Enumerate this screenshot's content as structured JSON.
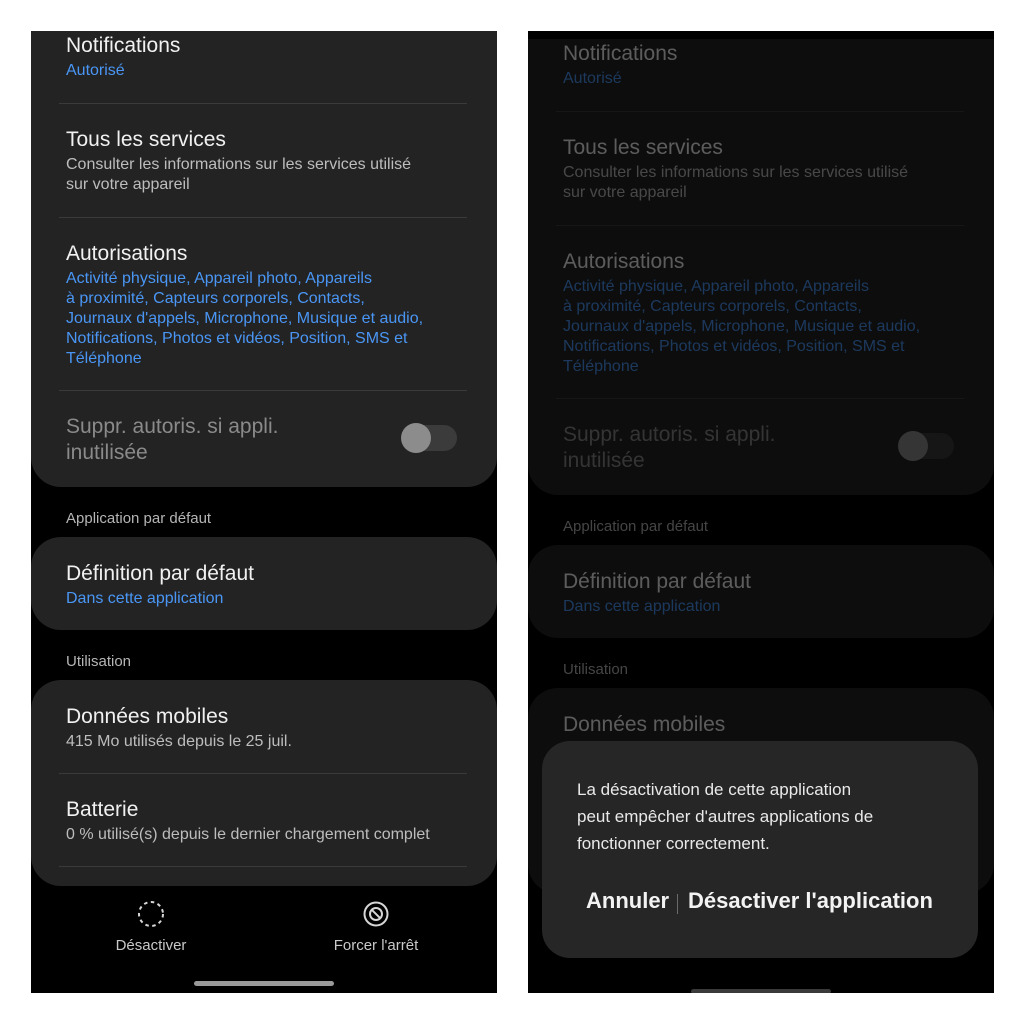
{
  "settings": {
    "notifications": {
      "title": "Notifications",
      "value": "Autorisé"
    },
    "services": {
      "title": "Tous les services",
      "desc_line1": "Consulter les informations sur les services utilisé",
      "desc_line2": "sur votre appareil"
    },
    "permissions": {
      "title": "Autorisations",
      "lines": [
        "Activité physique, Appareil photo, Appareils",
        "à proximité, Capteurs corporels, Contacts,",
        "Journaux d'appels, Microphone, Musique et audio,",
        "Notifications, Photos et vidéos, Position, SMS et",
        "Téléphone"
      ]
    },
    "remove_perms": {
      "line1": "Suppr. autoris. si appli.",
      "line2": "inutilisée",
      "enabled": false
    },
    "default_app_section": "Application par défaut",
    "default_setting": {
      "title": "Définition par défaut",
      "value": "Dans cette application"
    },
    "usage_section": "Utilisation",
    "mobile_data": {
      "title": "Données mobiles",
      "value": "415 Mo utilisés depuis le 25 juil."
    },
    "battery": {
      "title": "Batterie",
      "value": "0 % utilisé(s) depuis le dernier chargement complet"
    }
  },
  "bottom_bar": {
    "disable": {
      "label": "Désactiver",
      "icon": "dashed-circle-icon"
    },
    "force_stop": {
      "label": "Forcer l'arrêt",
      "icon": "stop-circle-icon"
    }
  },
  "dialog": {
    "message_lines": [
      "La désactivation de cette application",
      "peut empêcher d'autres applications de",
      "fonctionner correctement."
    ],
    "cancel_label": "Annuler",
    "confirm_label": "Désactiver l'application"
  },
  "colors": {
    "card_bg": "#232323",
    "link_blue": "#4a96f5",
    "dialog_bg": "#262626"
  }
}
